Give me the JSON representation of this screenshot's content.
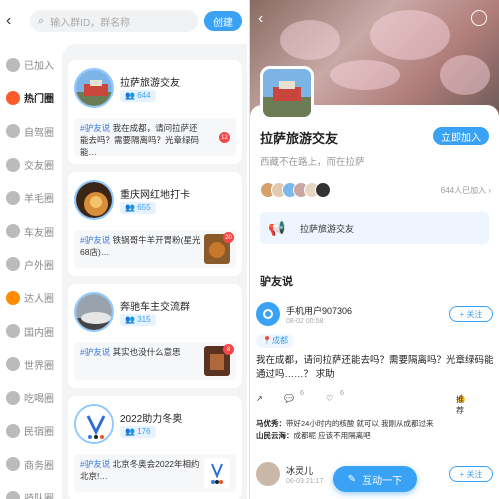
{
  "left": {
    "search": {
      "placeholder": "输入群ID，群名称"
    },
    "create_label": "创建",
    "sidebar": [
      {
        "label": "已加入",
        "icon": "plus-circle-icon",
        "color": "#bbbbbb"
      },
      {
        "label": "热门圈",
        "icon": "fire-icon",
        "color": "#ff5a2a",
        "active": true
      },
      {
        "label": "自驾圈",
        "icon": "car-icon",
        "color": "#bbbbbb"
      },
      {
        "label": "交友圈",
        "icon": "eye-icon",
        "color": "#bbbbbb"
      },
      {
        "label": "羊毛圈",
        "icon": "yarn-icon",
        "color": "#bbbbbb"
      },
      {
        "label": "车友圈",
        "icon": "car-icon",
        "color": "#bbbbbb"
      },
      {
        "label": "户外圈",
        "icon": "tent-icon",
        "color": "#bbbbbb"
      },
      {
        "label": "达人圈",
        "icon": "smile-icon",
        "color": "#ff8c00"
      },
      {
        "label": "国内圈",
        "icon": "flag-icon",
        "color": "#bbbbbb"
      },
      {
        "label": "世界圈",
        "icon": "globe-icon",
        "color": "#bbbbbb"
      },
      {
        "label": "吃喝圈",
        "icon": "food-icon",
        "color": "#bbbbbb"
      },
      {
        "label": "民宿圈",
        "icon": "house-icon",
        "color": "#bbbbbb"
      },
      {
        "label": "商务圈",
        "icon": "briefcase-icon",
        "color": "#bbbbbb"
      },
      {
        "label": "骑队圈",
        "icon": "bike-icon",
        "color": "#bbbbbb"
      }
    ],
    "cards": [
      {
        "name": "拉萨旅游交友",
        "count": "644",
        "tag": "#驴友说",
        "text": "我在成都，请问拉萨还能去吗？需要隔离吗？光章绿码能…",
        "badge": "12"
      },
      {
        "name": "重庆网红地打卡",
        "count": "655",
        "tag": "#驴友说",
        "text": "铁锅哥牛羊开胃粉(星光68店)…",
        "badge": "20"
      },
      {
        "name": "奔驰车主交流群",
        "count": "315",
        "tag": "#驴友说",
        "text": "其实也没什么意思",
        "badge": "8"
      },
      {
        "name": "2022助力冬奥",
        "count": "176",
        "tag": "#驴友说",
        "text": "北京冬奥会2022年相约北京!…",
        "badge": ""
      }
    ]
  },
  "right": {
    "group_title": "拉萨旅游交友",
    "join_label": "立即加入",
    "desc": "西藏不在路上，而在拉萨",
    "member_count": "644人已加入 ›",
    "notice": "拉萨旅游交友",
    "section_title": "驴友说",
    "posts": [
      {
        "user": "手机用户907306",
        "time": "08-02 00:58",
        "follow": "+ 关注",
        "location": "成都",
        "text": "我在成都，请问拉萨还能去吗？需要隔离吗？光章绿码能通过吗……？ 求助",
        "likes": "6",
        "comments": "6",
        "recommend": "推荐",
        "comment_list": [
          {
            "who": "马优秀：",
            "text": "带好24小时内的核酸 就可以 我刚从成都过来"
          },
          {
            "who": "山民云海：",
            "text": "成都呢 应该不用隔离吧"
          }
        ]
      },
      {
        "user": "冰灵儿",
        "time": "06-03 21:17",
        "follow": "+ 关注"
      }
    ],
    "fab_label": "互动一下"
  }
}
